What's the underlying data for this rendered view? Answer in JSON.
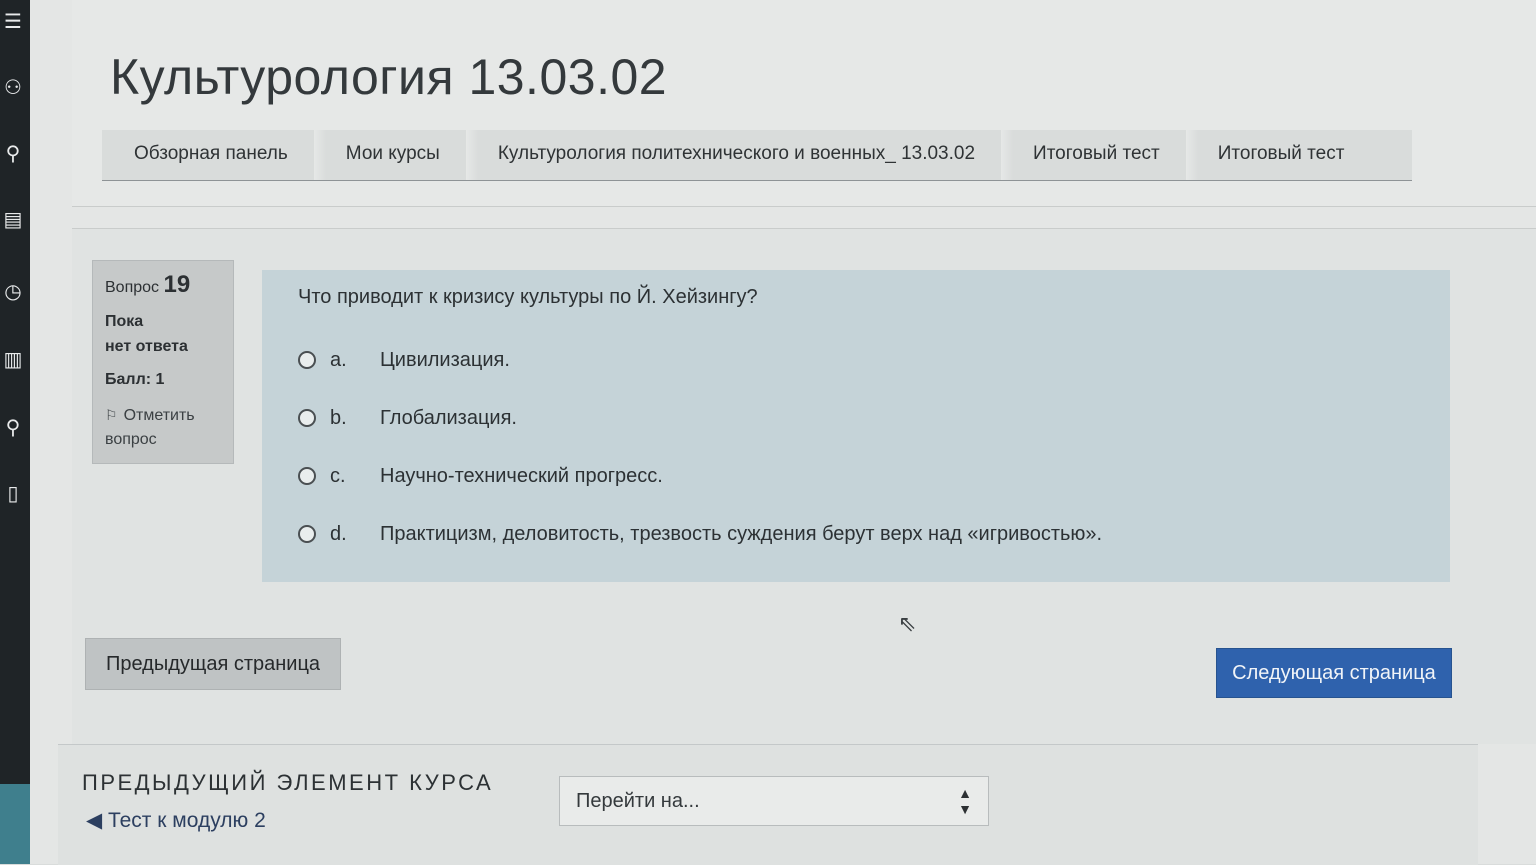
{
  "page_title": "Культурология 13.03.02",
  "breadcrumb": [
    "Обзорная панель",
    "Мои курсы",
    "Культурология политехнического и военных_ 13.03.02",
    "Итоговый тест",
    "Итоговый тест"
  ],
  "question_info": {
    "label": "Вопрос",
    "number": "19",
    "status": [
      "Пока",
      "нет ответа"
    ],
    "grade": "Балл: 1",
    "flag_label": [
      "Отметить",
      "вопрос"
    ]
  },
  "question": {
    "text": "Что приводит к кризису культуры по Й. Хейзингу?",
    "answers": [
      {
        "letter": "a.",
        "text": "Цивилизация."
      },
      {
        "letter": "b.",
        "text": "Глобализация."
      },
      {
        "letter": "c.",
        "text": "Научно-технический прогресс."
      },
      {
        "letter": "d.",
        "text": "Практицизм, деловитость, трезвость суждения берут верх над «игривостью»."
      }
    ]
  },
  "navigation": {
    "prev_button": "Предыдущая страница",
    "next_button": "Следующая страница"
  },
  "activity_nav": {
    "heading": "ПРЕДЫДУЩИЙ ЭЛЕМЕНТ КУРСА",
    "prev_link": "Тест к модулю 2",
    "jump_placeholder": "Перейти на..."
  },
  "colors": {
    "primary_button": "#2f62ad",
    "formulation_bg": "#c5d3d8",
    "sidebar_bg": "#1f2427"
  },
  "icons": [
    "menu-icon",
    "users-icon",
    "search-icon",
    "list-icon",
    "clock-icon",
    "book-icon",
    "flag-icon",
    "cursor-icon"
  ]
}
